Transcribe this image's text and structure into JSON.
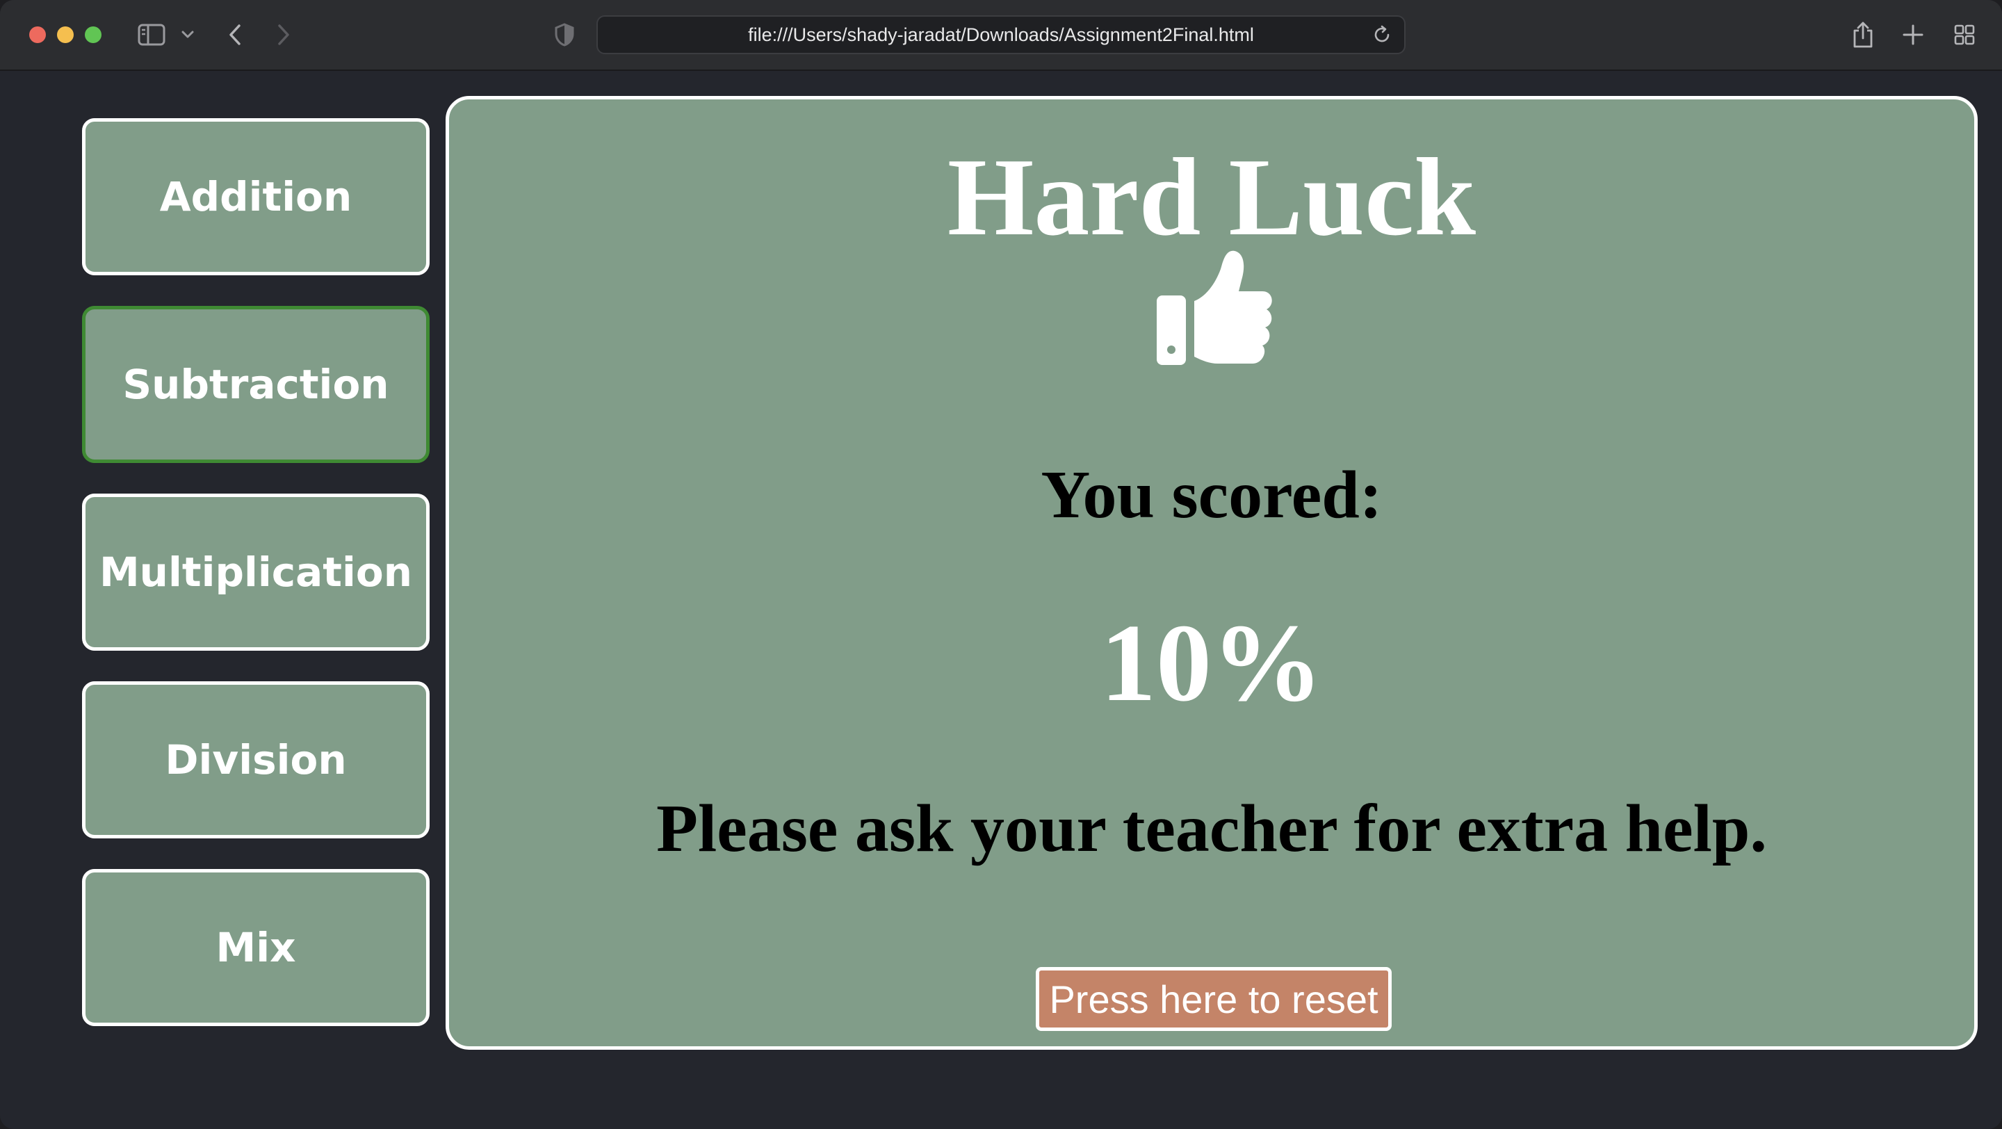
{
  "browser": {
    "url": "file:///Users/shady-jaradat/Downloads/Assignment2Final.html",
    "icons": [
      "sidebar-icon",
      "chevron-down-icon",
      "back-icon",
      "forward-icon",
      "shield-icon",
      "reload-icon",
      "share-icon",
      "new-tab-icon",
      "tab-overview-icon"
    ]
  },
  "sidebar": {
    "items": [
      {
        "label": "Addition"
      },
      {
        "label": "Subtraction",
        "active": true
      },
      {
        "label": "Multiplication"
      },
      {
        "label": "Division"
      },
      {
        "label": "Mix"
      }
    ]
  },
  "result": {
    "title": "Hard Luck",
    "icon": "thumbs-up-icon",
    "scored_label": "You scored:",
    "score": "10%",
    "message": "Please ask your teacher for extra help.",
    "reset_label": "Press here to reset"
  },
  "colors": {
    "panel_bg": "#819d89",
    "page_bg": "#24262d",
    "active_border": "#3f8a33",
    "reset_bg": "#c48468"
  }
}
